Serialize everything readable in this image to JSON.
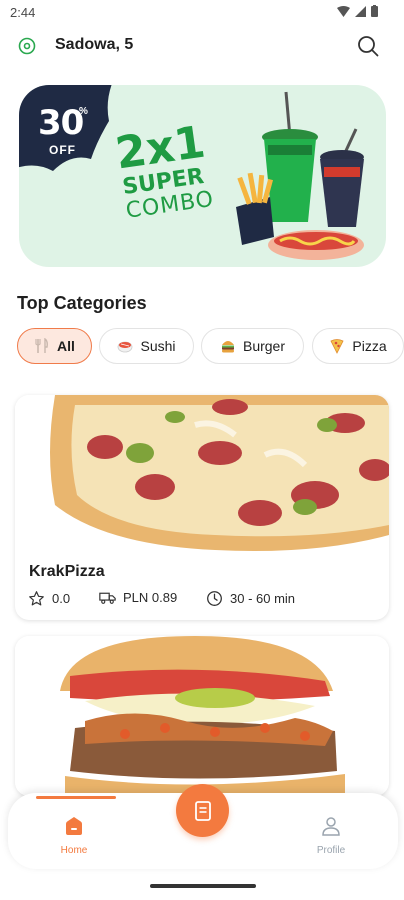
{
  "status_bar": {
    "time": "2:44"
  },
  "header": {
    "address": "Sadowa, 5"
  },
  "banner": {
    "discount_number": "30",
    "discount_percent": "%",
    "discount_off": "OFF",
    "headline": "2x1",
    "line2": "SUPER",
    "line3": "COMBO"
  },
  "categories": {
    "title": "Top Categories",
    "items": [
      {
        "label": "All",
        "icon": "cutlery-icon",
        "active": true
      },
      {
        "label": "Sushi",
        "icon": "sushi-icon",
        "active": false
      },
      {
        "label": "Burger",
        "icon": "burger-icon",
        "active": false
      },
      {
        "label": "Pizza",
        "icon": "pizza-icon",
        "active": false
      }
    ]
  },
  "restaurants": [
    {
      "name": "KrakPizza",
      "rating": "0.0",
      "delivery_fee": "PLN 0.89",
      "delivery_time": "30 - 60 min"
    }
  ],
  "bottom_nav": {
    "home_label": "Home",
    "profile_label": "Profile"
  },
  "colors": {
    "accent": "#f37a3f",
    "promo_green": "#1f9b43",
    "banner_bg": "#dff3e6",
    "promo_badge": "#1f2a44"
  }
}
